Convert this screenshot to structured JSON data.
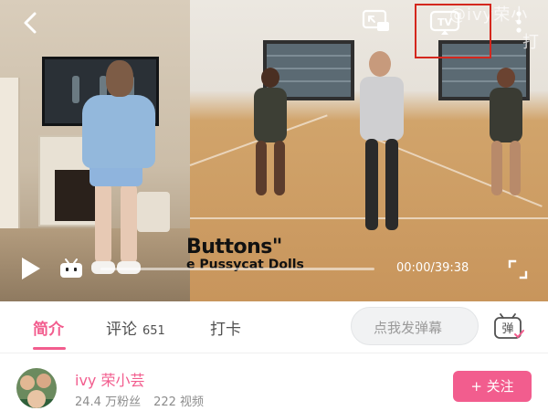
{
  "player": {
    "watermark": "@ivy荣小",
    "watermark_line2": "打",
    "caption_line1": "Buttons\"",
    "caption_line2": "e Pussycat Dolls",
    "time_display": "00:00/39:38",
    "progress": 0.0,
    "icons": {
      "back": "back-arrow-icon",
      "cast": "screen-cast-icon",
      "tv": "tv-cast-icon",
      "more": "more-vertical-icon",
      "play": "play-icon",
      "bili": "bilibili-tv-icon",
      "fullscreen": "fullscreen-icon"
    },
    "tv_label": "TV"
  },
  "tabs": {
    "items": [
      {
        "label": "简介",
        "active": true
      },
      {
        "label": "评论",
        "count": "651",
        "active": false
      },
      {
        "label": "打卡",
        "active": false
      }
    ],
    "danmaku_placeholder": "点我发弹幕",
    "danmaku_btn_glyph": "弹"
  },
  "uploader": {
    "name": "ivy 荣小芸",
    "followers": "24.4 万粉丝",
    "videos": "222 视频",
    "follow_label": "+ 关注"
  },
  "colors": {
    "accent": "#f25d8e",
    "highlight_box": "#d4271d"
  }
}
